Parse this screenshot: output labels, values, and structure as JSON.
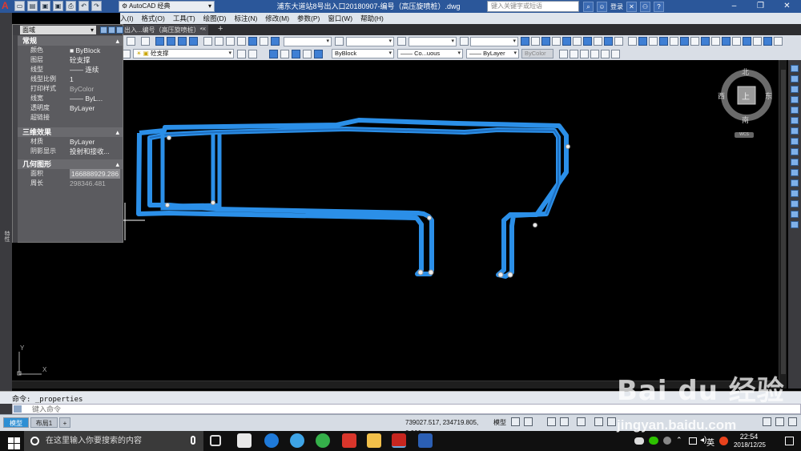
{
  "app": {
    "window_title": "浦东大道站8号出入口20180907-编号（高压旋喷桩）.dwg",
    "workspace": "AutoCAD 经典",
    "search_placeholder": "键入关键字或短语",
    "sign_in": "登录",
    "accent": "#2b579a"
  },
  "menu": [
    "入(I)",
    "格式(O)",
    "工具(T)",
    "绘图(D)",
    "标注(N)",
    "修改(M)",
    "参数(P)",
    "窗口(W)",
    "帮助(H)"
  ],
  "file_tab": {
    "label": "出入...编号（高压旋喷桩）*",
    "close": "×",
    "add": "+"
  },
  "toolbar": {
    "layer_combo": "砼支撑",
    "color_combo": "ByBlock",
    "linetype_combo": "—— Co...uous",
    "lineweight_combo": "—— ByLayer",
    "plotstyle_combo": "ByColor"
  },
  "properties": {
    "selection": "面域",
    "sections": [
      {
        "title": "常规",
        "rows": [
          {
            "key": "颜色",
            "value": "■ ByBlock"
          },
          {
            "key": "图层",
            "value": "砼支撑"
          },
          {
            "key": "线型",
            "value": "—— 连续"
          },
          {
            "key": "线型比例",
            "value": "1"
          },
          {
            "key": "打印样式",
            "value": "ByColor"
          },
          {
            "key": "线宽",
            "value": "—— ByL..."
          },
          {
            "key": "透明度",
            "value": "ByLayer"
          },
          {
            "key": "超链接",
            "value": ""
          }
        ]
      },
      {
        "title": "三维效果",
        "rows": [
          {
            "key": "材质",
            "value": "ByLayer"
          },
          {
            "key": "阴影显示",
            "value": "投射和接收..."
          }
        ]
      },
      {
        "title": "几何图形",
        "rows": [
          {
            "key": "面积",
            "value": "166888929.286"
          },
          {
            "key": "周长",
            "value": "298346.481"
          }
        ]
      }
    ]
  },
  "left_strip_label": "特性",
  "viewcube": {
    "north": "北",
    "south": "南",
    "east": "东",
    "west": "西",
    "face": "上",
    "wcs": "WCS"
  },
  "ucs": {
    "x": "X",
    "y": "Y"
  },
  "command": {
    "history": "命令: _properties",
    "placeholder": "键入命令"
  },
  "layout_tabs": [
    "模型",
    "布局1"
  ],
  "status": {
    "coords": "739027.517, 234719.805, 0.000",
    "space": "模型"
  },
  "taskbar": {
    "search_placeholder": "在这里输入你要搜索的内容",
    "ime": "英",
    "time": "22:54",
    "date": "2018/12/25"
  },
  "watermark": {
    "logo": "Bai du 经验",
    "url": "jingyan.baidu.com"
  }
}
